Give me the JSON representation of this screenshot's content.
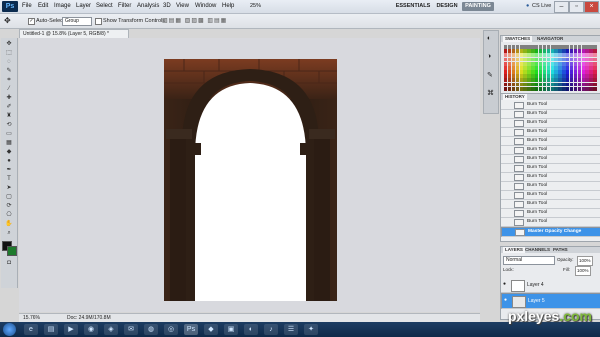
{
  "menubar": {
    "logo": "Ps",
    "items": [
      "File",
      "Edit",
      "Image",
      "Layer",
      "Select",
      "Filter",
      "Analysis",
      "3D",
      "View",
      "Window",
      "Help"
    ],
    "zoom": "25%",
    "workspaces": [
      "ESSENTIALS",
      "DESIGN",
      "PAINTING"
    ],
    "active_workspace": "PAINTING",
    "cslive": "CS Live"
  },
  "options": {
    "auto_select_label": "Auto-Select:",
    "auto_select_value": "Group",
    "show_transform_label": "Show Transform Controls"
  },
  "document": {
    "tab_title": "Untitled-1 @ 15.8% (Layer 5, RGB/8) *",
    "zoom_status": "15.76%",
    "doc_status": "Doc: 24.9M/170.8M"
  },
  "panels": {
    "swatches_tab": "SWATCHES",
    "navigator_tab": "NAVIGATOR",
    "history_tab": "HISTORY",
    "history_items": [
      "Burn Tool",
      "Burn Tool",
      "Burn Tool",
      "Burn Tool",
      "Burn Tool",
      "Burn Tool",
      "Burn Tool",
      "Burn Tool",
      "Burn Tool",
      "Burn Tool",
      "Burn Tool",
      "Burn Tool",
      "Burn Tool",
      "Burn Tool",
      "Master Opacity Change"
    ],
    "layers_tab": "LAYERS",
    "channels_tab": "CHANNELS",
    "paths_tab": "PATHS",
    "blend_mode": "Normal",
    "opacity_label": "Opacity:",
    "opacity_value": "100%",
    "fill_label": "Fill:",
    "fill_value": "100%",
    "lock_label": "Lock:",
    "layers": [
      {
        "name": "Layer 4",
        "selected": false
      },
      {
        "name": "Layer 5",
        "selected": true
      }
    ]
  },
  "watermark": {
    "main": "pxleyes",
    "tld": ".com"
  },
  "colors": {
    "accent": "#3d93e8",
    "taskbar": "#1d3d63"
  }
}
